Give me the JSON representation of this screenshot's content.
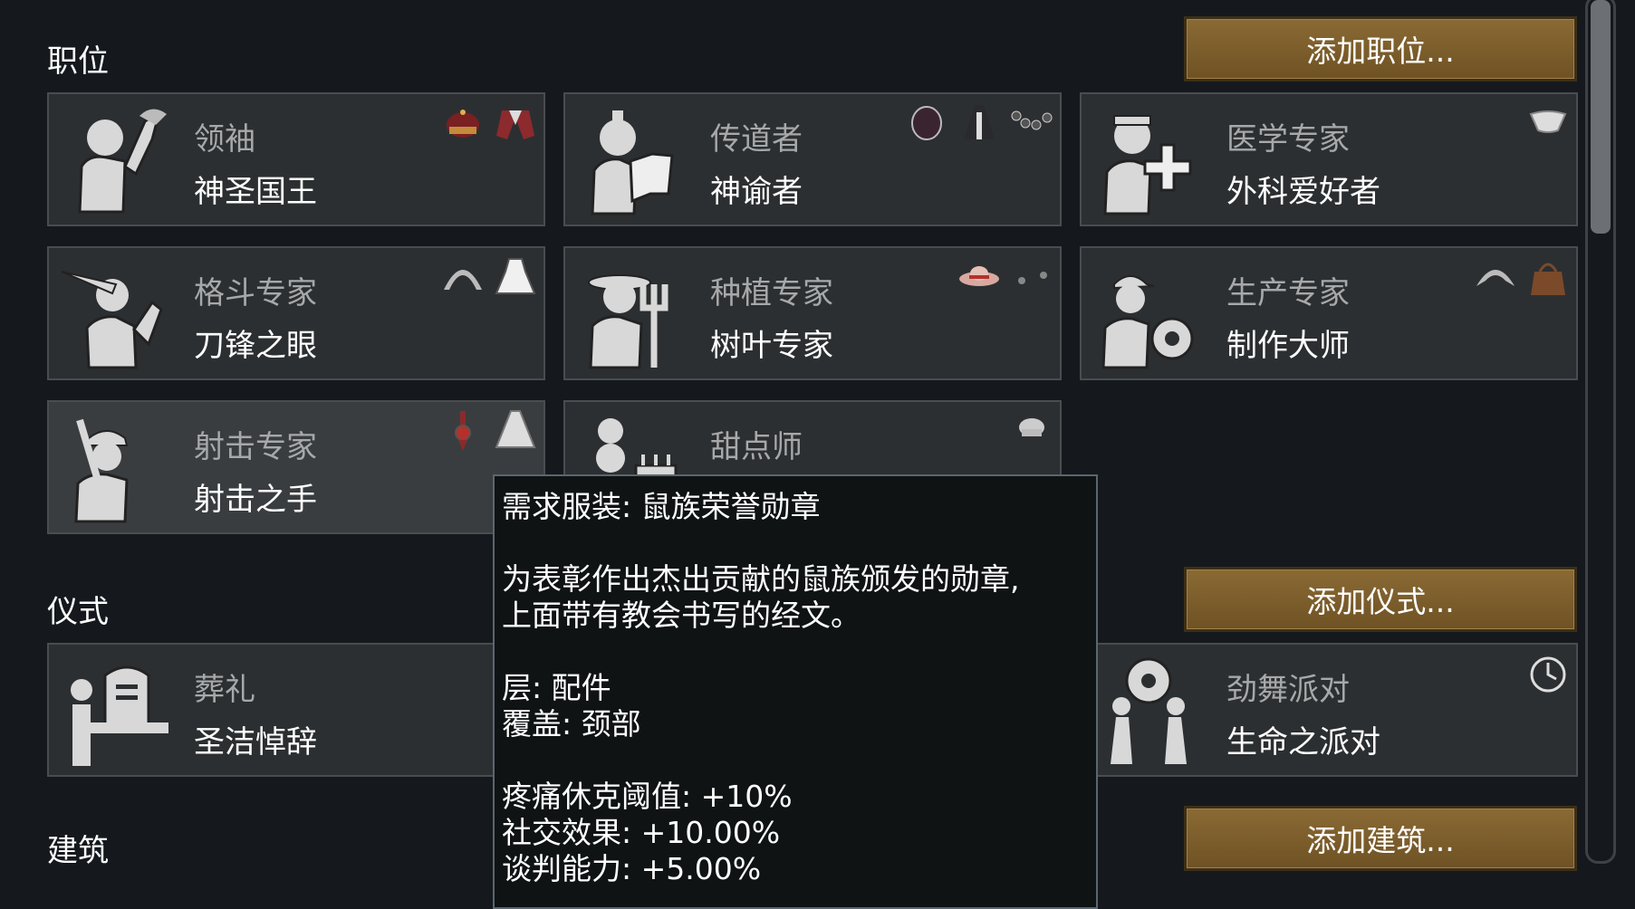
{
  "sections": {
    "roles": {
      "title": "职位",
      "add_button": "添加职位..."
    },
    "rituals": {
      "title": "仪式",
      "add_button": "添加仪式..."
    },
    "buildings": {
      "title": "建筑",
      "add_button": "添加建筑..."
    }
  },
  "roles": [
    {
      "title": "领袖",
      "name": "神圣国王",
      "icons": [
        "crown-icon",
        "robe-icon"
      ]
    },
    {
      "title": "传道者",
      "name": "神谕者",
      "icons": [
        "hood-icon",
        "vestment-icon",
        "beads-icon"
      ]
    },
    {
      "title": "医学专家",
      "name": "外科爱好者",
      "icons": [
        "mask-icon"
      ]
    },
    {
      "title": "格斗专家",
      "name": "刀锋之眼",
      "icons": [
        "horn-headband-icon",
        "frilled-dress-icon"
      ]
    },
    {
      "title": "种植专家",
      "name": "树叶专家",
      "icons": [
        "straw-hat-icon",
        "earrings-icon"
      ]
    },
    {
      "title": "生产专家",
      "name": "制作大师",
      "icons": [
        "visor-icon",
        "leather-bag-icon"
      ]
    },
    {
      "title": "射击专家",
      "name": "射击之手",
      "icons": [
        "medal-icon",
        "cape-icon"
      ]
    },
    {
      "title": "甜点师",
      "name": "",
      "icons": [
        "chef-hat-icon"
      ]
    }
  ],
  "rituals": [
    {
      "title": "葬礼",
      "name": "圣洁悼辞"
    },
    {
      "title": "劲舞派对",
      "name": "生命之派对",
      "icons": [
        "clock-icon"
      ]
    }
  ],
  "tooltip": {
    "header": "需求服装: 鼠族荣誉勋章",
    "description_1": "为表彰作出杰出贡献的鼠族颁发的勋章,",
    "description_2": "上面带有教会书写的经文。",
    "layer": "层: 配件",
    "covers": "覆盖: 颈部",
    "stat_1": "疼痛休克阈值: +10%",
    "stat_2": "社交效果: +10.00%",
    "stat_3": "谈判能力: +5.00%"
  },
  "colors": {
    "background": "#15191d",
    "card": "#2c2f31",
    "button": "#7a5c2b",
    "role_title": "#a7a8aa"
  }
}
